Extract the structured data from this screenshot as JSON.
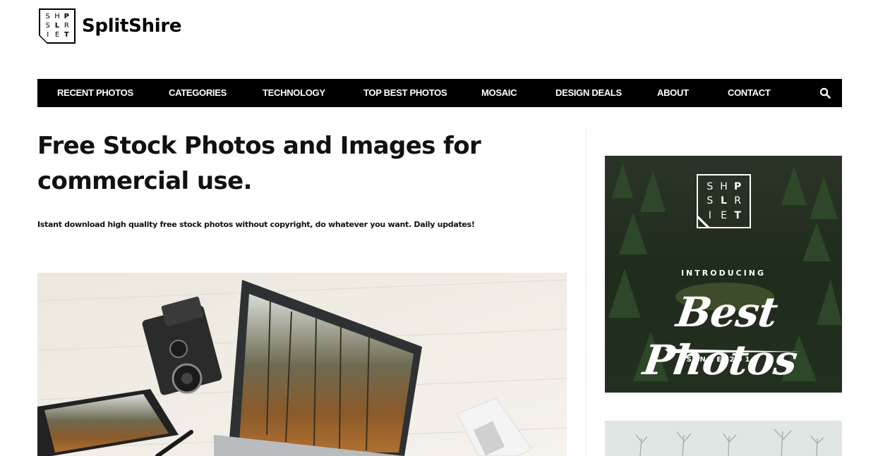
{
  "header": {
    "logo_letters": [
      "S",
      "H",
      "P",
      "S",
      "L",
      "R",
      "I",
      "E",
      "T"
    ],
    "site_name": "SplitShire"
  },
  "nav": {
    "items": [
      {
        "label": "RECENT PHOTOS"
      },
      {
        "label": "CATEGORIES"
      },
      {
        "label": "TECHNOLOGY"
      },
      {
        "label": "TOP BEST PHOTOS"
      },
      {
        "label": "MOSAIC"
      },
      {
        "label": "DESIGN DEALS"
      },
      {
        "label": "ABOUT"
      },
      {
        "label": "CONTACT"
      }
    ],
    "search_icon": "search-icon"
  },
  "main": {
    "headline": "Free Stock Photos and Images for commercial use.",
    "tagline": "Istant download high quality free stock photos without copyright, do whatever you want. Daily updates!",
    "hero_image": "desk-with-laptop-camera-tablet-photo"
  },
  "sidebar": {
    "promo": {
      "logo_letters": [
        "S",
        "H",
        "P",
        "S",
        "L",
        "R",
        "I",
        "E",
        "T"
      ],
      "intro": "INTRODUCING",
      "title": "Best Photos",
      "since": "SINCE 2014"
    },
    "second_thumb": "winter-trees-photo"
  },
  "colors": {
    "nav_bg": "#000000",
    "nav_text": "#ffffff",
    "text": "#111111"
  }
}
